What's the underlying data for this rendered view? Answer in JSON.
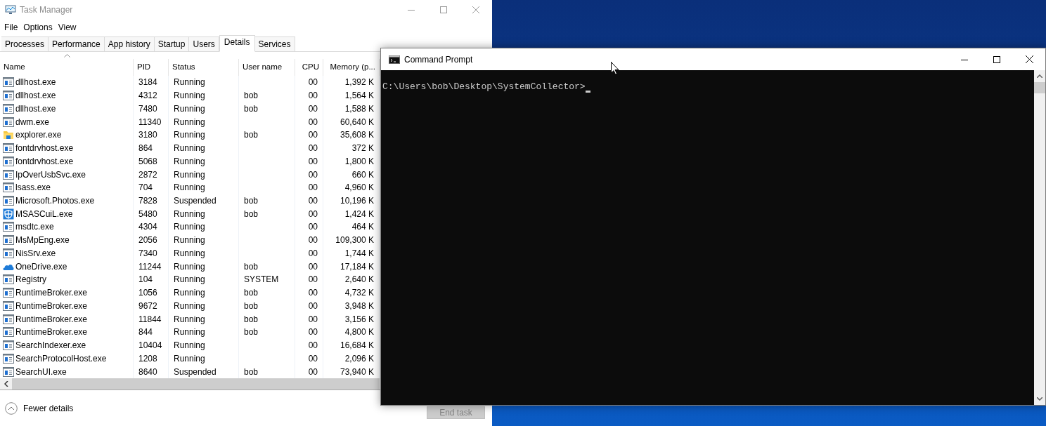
{
  "task_manager": {
    "title": "Task Manager",
    "menu": [
      "File",
      "Options",
      "View"
    ],
    "tabs": [
      {
        "label": "Processes",
        "selected": false
      },
      {
        "label": "Performance",
        "selected": false
      },
      {
        "label": "App history",
        "selected": false
      },
      {
        "label": "Startup",
        "selected": false
      },
      {
        "label": "Users",
        "selected": false
      },
      {
        "label": "Details",
        "selected": true
      },
      {
        "label": "Services",
        "selected": false
      }
    ],
    "columns": [
      {
        "label": "Name",
        "sorted": true
      },
      {
        "label": "PID",
        "sorted": false
      },
      {
        "label": "Status",
        "sorted": false
      },
      {
        "label": "User name",
        "sorted": false
      },
      {
        "label": "CPU",
        "sorted": false
      },
      {
        "label": "Memory (p...",
        "sorted": false
      }
    ],
    "rows": [
      {
        "kind": "app",
        "name": "dllhost.exe",
        "pid": "3184",
        "status": "Running",
        "user": "",
        "cpu": "00",
        "memory": "1,392 K"
      },
      {
        "kind": "app",
        "name": "dllhost.exe",
        "pid": "4312",
        "status": "Running",
        "user": "bob",
        "cpu": "00",
        "memory": "1,564 K"
      },
      {
        "kind": "app",
        "name": "dllhost.exe",
        "pid": "7480",
        "status": "Running",
        "user": "bob",
        "cpu": "00",
        "memory": "1,588 K"
      },
      {
        "kind": "app",
        "name": "dwm.exe",
        "pid": "11340",
        "status": "Running",
        "user": "",
        "cpu": "00",
        "memory": "60,640 K"
      },
      {
        "kind": "folder",
        "name": "explorer.exe",
        "pid": "3180",
        "status": "Running",
        "user": "bob",
        "cpu": "00",
        "memory": "35,608 K"
      },
      {
        "kind": "app",
        "name": "fontdrvhost.exe",
        "pid": "864",
        "status": "Running",
        "user": "",
        "cpu": "00",
        "memory": "372 K"
      },
      {
        "kind": "app",
        "name": "fontdrvhost.exe",
        "pid": "5068",
        "status": "Running",
        "user": "",
        "cpu": "00",
        "memory": "1,800 K"
      },
      {
        "kind": "app",
        "name": "IpOverUsbSvc.exe",
        "pid": "2872",
        "status": "Running",
        "user": "",
        "cpu": "00",
        "memory": "660 K"
      },
      {
        "kind": "app",
        "name": "lsass.exe",
        "pid": "704",
        "status": "Running",
        "user": "",
        "cpu": "00",
        "memory": "4,960 K"
      },
      {
        "kind": "app",
        "name": "Microsoft.Photos.exe",
        "pid": "7828",
        "status": "Suspended",
        "user": "bob",
        "cpu": "00",
        "memory": "10,196 K"
      },
      {
        "kind": "shield",
        "name": "MSASCuiL.exe",
        "pid": "5480",
        "status": "Running",
        "user": "bob",
        "cpu": "00",
        "memory": "1,424 K"
      },
      {
        "kind": "app",
        "name": "msdtc.exe",
        "pid": "4304",
        "status": "Running",
        "user": "",
        "cpu": "00",
        "memory": "464 K"
      },
      {
        "kind": "app",
        "name": "MsMpEng.exe",
        "pid": "2056",
        "status": "Running",
        "user": "",
        "cpu": "00",
        "memory": "109,300 K"
      },
      {
        "kind": "app",
        "name": "NisSrv.exe",
        "pid": "7340",
        "status": "Running",
        "user": "",
        "cpu": "00",
        "memory": "1,744 K"
      },
      {
        "kind": "cloud",
        "name": "OneDrive.exe",
        "pid": "11244",
        "status": "Running",
        "user": "bob",
        "cpu": "00",
        "memory": "17,184 K"
      },
      {
        "kind": "app",
        "name": "Registry",
        "pid": "104",
        "status": "Running",
        "user": "SYSTEM",
        "cpu": "00",
        "memory": "2,640 K"
      },
      {
        "kind": "app",
        "name": "RuntimeBroker.exe",
        "pid": "1056",
        "status": "Running",
        "user": "bob",
        "cpu": "00",
        "memory": "4,732 K"
      },
      {
        "kind": "app",
        "name": "RuntimeBroker.exe",
        "pid": "9672",
        "status": "Running",
        "user": "bob",
        "cpu": "00",
        "memory": "3,948 K"
      },
      {
        "kind": "app",
        "name": "RuntimeBroker.exe",
        "pid": "11844",
        "status": "Running",
        "user": "bob",
        "cpu": "00",
        "memory": "3,156 K"
      },
      {
        "kind": "app",
        "name": "RuntimeBroker.exe",
        "pid": "844",
        "status": "Running",
        "user": "bob",
        "cpu": "00",
        "memory": "4,800 K"
      },
      {
        "kind": "app",
        "name": "SearchIndexer.exe",
        "pid": "10404",
        "status": "Running",
        "user": "",
        "cpu": "00",
        "memory": "16,684 K"
      },
      {
        "kind": "app",
        "name": "SearchProtocolHost.exe",
        "pid": "1208",
        "status": "Running",
        "user": "",
        "cpu": "00",
        "memory": "2,096 K"
      },
      {
        "kind": "app",
        "name": "SearchUI.exe",
        "pid": "8640",
        "status": "Suspended",
        "user": "bob",
        "cpu": "00",
        "memory": "73,940 K"
      }
    ],
    "fewer_details": "Fewer details",
    "end_task": {
      "label": "End task",
      "disabled": true
    }
  },
  "command_prompt": {
    "title": "Command Prompt",
    "prompt": "C:\\Users\\bob\\Desktop\\SystemCollector>"
  }
}
